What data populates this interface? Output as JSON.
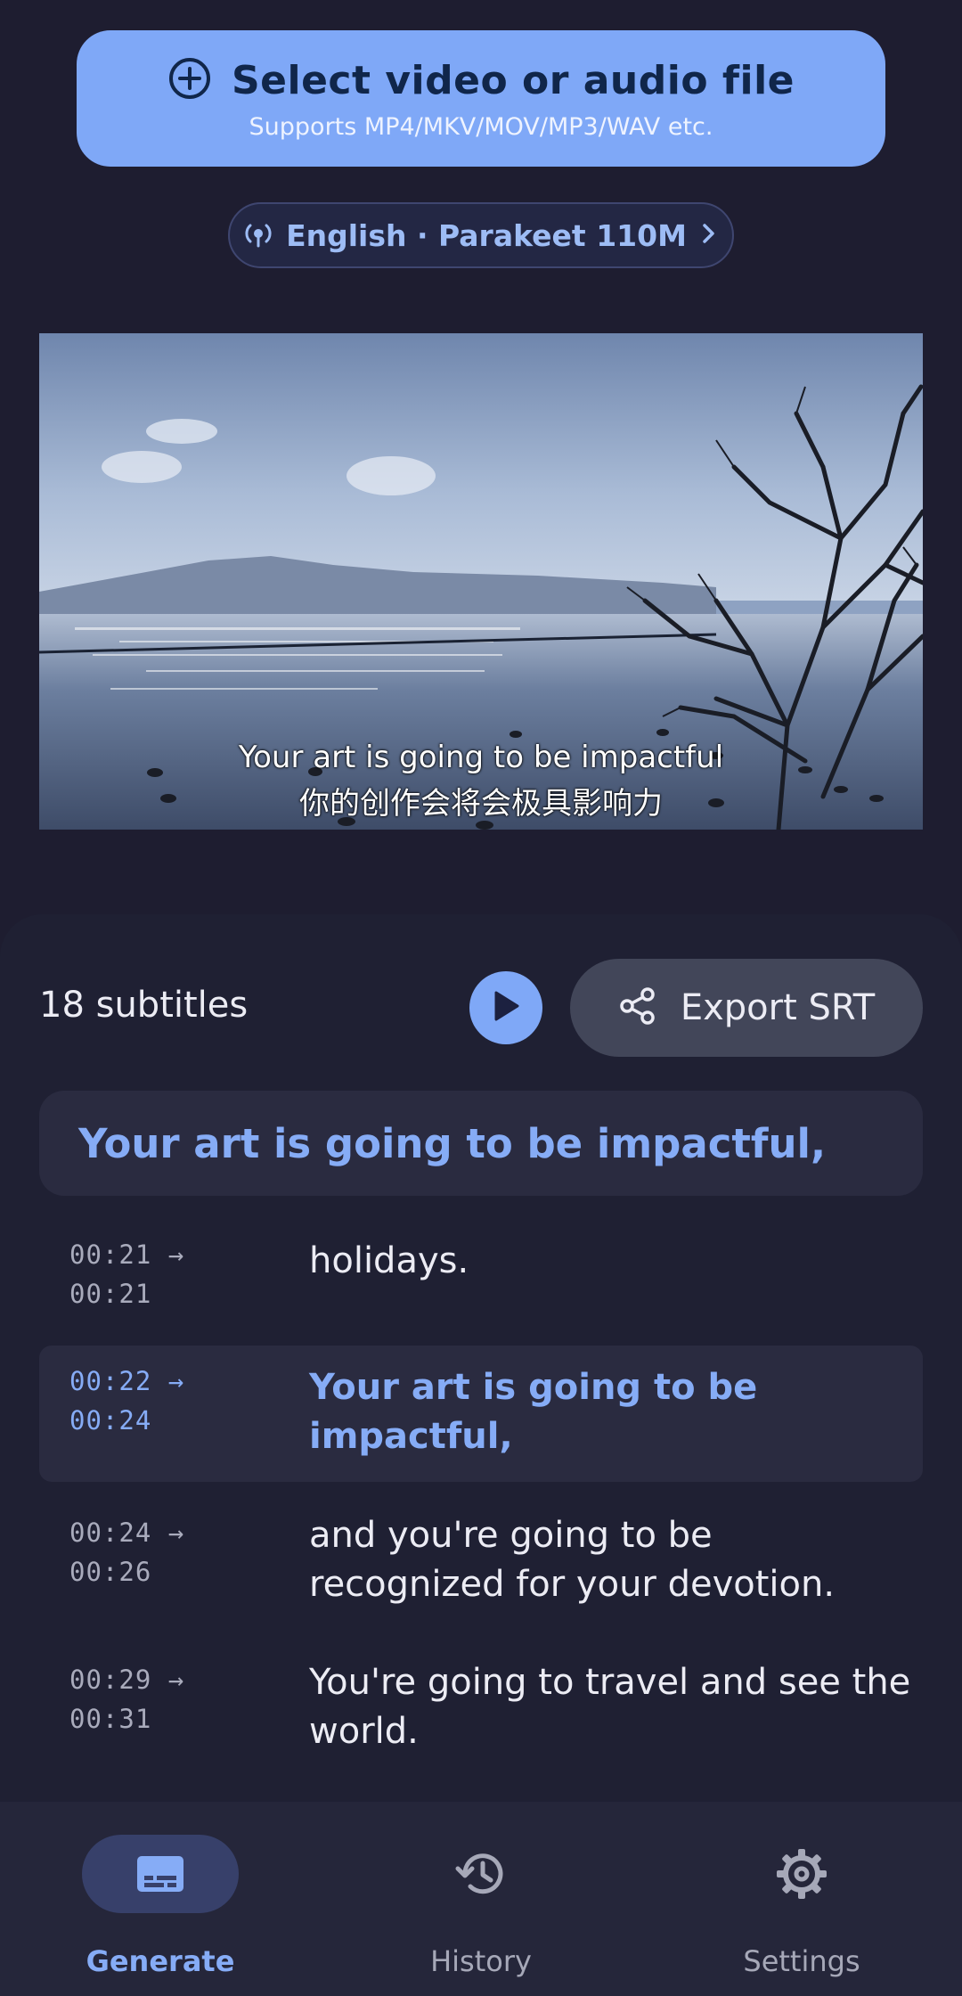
{
  "select_file": {
    "title": "Select video or audio file",
    "subtitle": "Supports MP4/MKV/MOV/MP3/WAV etc.",
    "icon": "add-circle-icon"
  },
  "model_chip": {
    "label": "English · Parakeet 110M",
    "icon": "model-icon",
    "chevron": "chevron-right-icon"
  },
  "video": {
    "caption_line1": "Your art is going to be impactful",
    "caption_line2": "你的创作会将会极具影响力"
  },
  "subtitles": {
    "count_label": "18 subtitles",
    "export_label": "Export SRT",
    "current": "Your art is going to be impactful,",
    "items": [
      {
        "start": "00:21 →",
        "end": "00:21",
        "text": "holidays.",
        "active": false
      },
      {
        "start": "00:22 →",
        "end": "00:24",
        "text": "Your art is going to be impactful,",
        "active": true
      },
      {
        "start": "00:24 →",
        "end": "00:26",
        "text": "and you're going to be recognized for your devotion.",
        "active": false
      },
      {
        "start": "00:29 →",
        "end": "00:31",
        "text": "You're going to travel and see the world.",
        "active": false
      }
    ]
  },
  "nav": {
    "items": [
      {
        "label": "Generate",
        "icon": "subtitles-icon",
        "active": true
      },
      {
        "label": "History",
        "icon": "history-icon",
        "active": false
      },
      {
        "label": "Settings",
        "icon": "gear-icon",
        "active": false
      }
    ]
  },
  "colors": {
    "background": "#1e1d30",
    "accent": "#7fa8f7",
    "accent_text": "#86acf6",
    "surface": "#2a2b40"
  }
}
